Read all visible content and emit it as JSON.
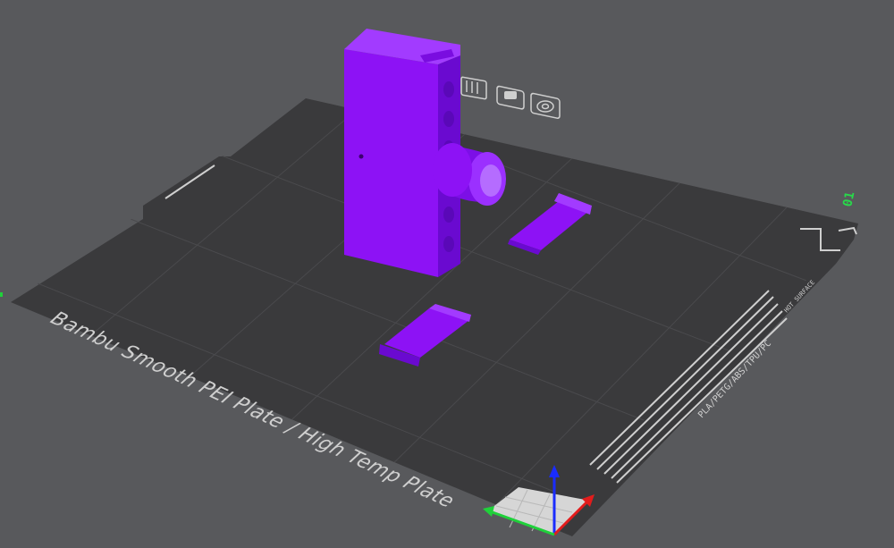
{
  "scene": {
    "plate_label": "Bambu Smooth PEI Plate / High Temp Plate",
    "plate_number": "01",
    "filament_types": "PLA/PETG/ABS/TPU/PC",
    "surface_hint": "HOT SURFACE"
  },
  "colors": {
    "background": "#58595c",
    "plate": "#3a3a3c",
    "grid": "#4a4a4d",
    "model": "#8d12f5",
    "model_dark": "#6a0ad0",
    "model_light": "#a23bff",
    "axis_x": "#e21c1c",
    "axis_y": "#1fd13a",
    "axis_z": "#1a2cff",
    "plate_number": "#28d94a"
  },
  "icons": {
    "view_icons": [
      "calibration-icon",
      "toggle-icon",
      "target-icon"
    ]
  }
}
